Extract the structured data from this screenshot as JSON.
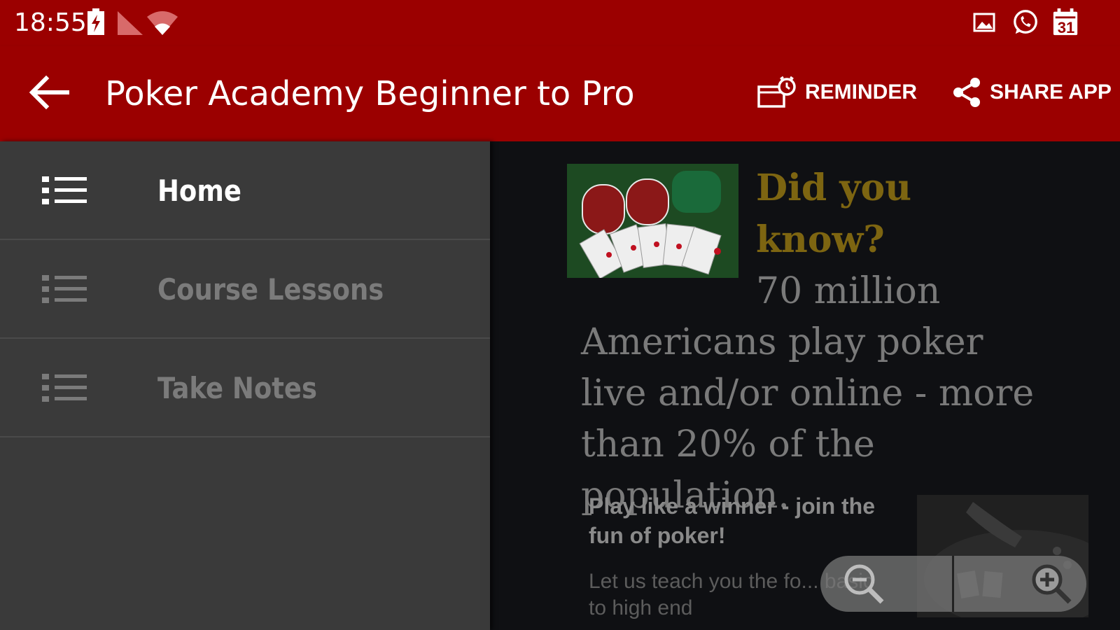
{
  "status_bar": {
    "time": "18:55",
    "calendar_day": "31",
    "icons": [
      "battery-charging-icon",
      "cell-signal-icon",
      "wifi-icon",
      "gallery-notification-icon",
      "whatsapp-icon",
      "calendar-icon"
    ]
  },
  "app_bar": {
    "title": "Poker Academy Beginner to Pro",
    "reminder_label": "REMINDER",
    "share_label": "SHARE APP",
    "background_color": "#9b0000"
  },
  "drawer": {
    "items": [
      {
        "label": "Home",
        "icon": "list-icon",
        "selected": true
      },
      {
        "label": "Course Lessons",
        "icon": "list-icon",
        "selected": false
      },
      {
        "label": "Take Notes",
        "icon": "list-icon",
        "selected": false
      }
    ],
    "selected_color": "#ffffff",
    "unselected_color": "#7b7b7b"
  },
  "content": {
    "fact_title": "Did you know?",
    "fact_text": "70 million Americans play poker live and/or online - more than 20% of the population.",
    "promo_title": "Play like a winner - join the fun of poker!",
    "promo_text": "Let us teach you the fo... basic to high end",
    "title_color": "#7d6511"
  },
  "zoom_control": {
    "zoom_out_icon": "zoom-out-icon",
    "zoom_in_icon": "zoom-in-icon"
  }
}
